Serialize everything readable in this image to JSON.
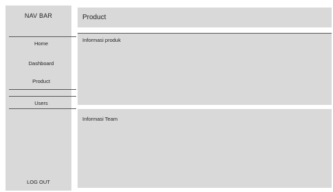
{
  "sidebar": {
    "brand": "NAV BAR",
    "items": [
      {
        "label": "Home"
      },
      {
        "label": "Dashboard"
      },
      {
        "label": "Product"
      },
      {
        "label": "Users"
      }
    ],
    "logout": "LOG OUT"
  },
  "header": {
    "title": "Product"
  },
  "panels": {
    "product_info": "Informasi produk",
    "team_info": "Informasi Team"
  }
}
